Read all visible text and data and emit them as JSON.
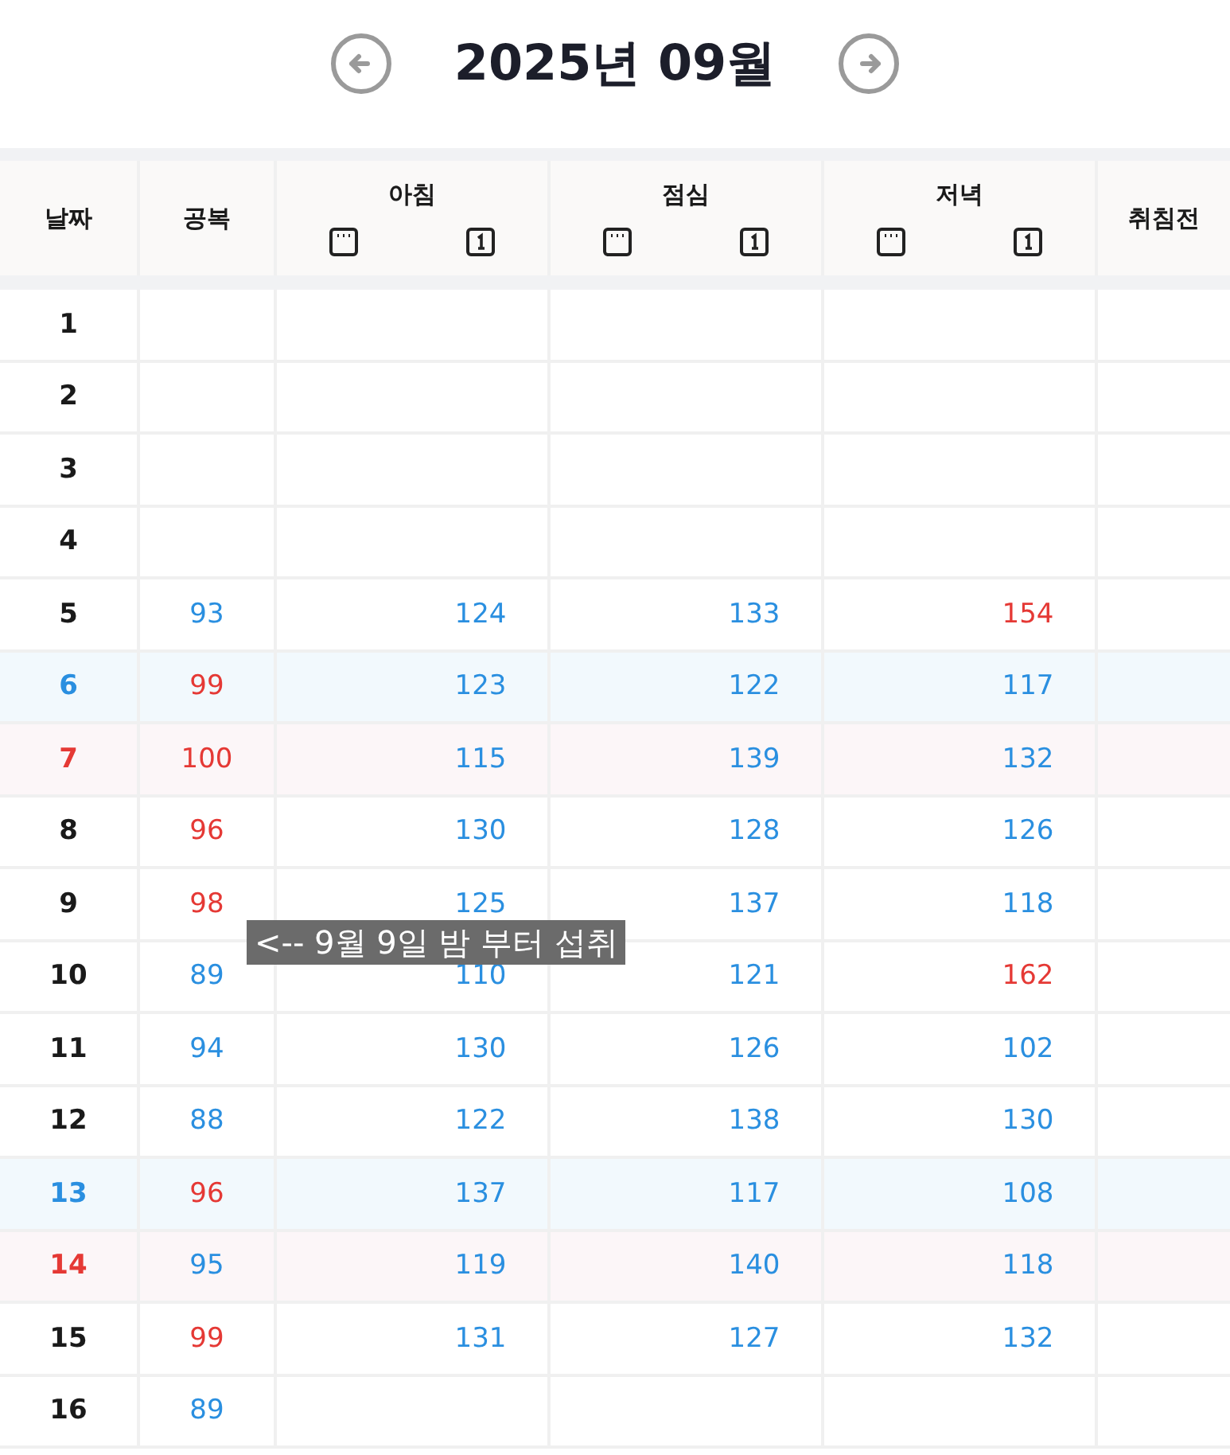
{
  "header": {
    "title": "2025년 09월"
  },
  "table": {
    "columns": [
      {
        "kind": "single",
        "label": "날짜"
      },
      {
        "kind": "single",
        "label": "공복"
      },
      {
        "kind": "meal",
        "label": "아침"
      },
      {
        "kind": "meal",
        "label": "점심"
      },
      {
        "kind": "meal",
        "label": "저녁"
      },
      {
        "kind": "single",
        "label": "취침전"
      }
    ],
    "rows": [
      {
        "date": "1",
        "kind": "weekday"
      },
      {
        "date": "2",
        "kind": "weekday"
      },
      {
        "date": "3",
        "kind": "weekday"
      },
      {
        "date": "4",
        "kind": "weekday"
      },
      {
        "date": "5",
        "kind": "weekday",
        "fasting": {
          "value": "93",
          "high": false
        },
        "breakfast": {
          "value": "124",
          "high": false
        },
        "lunch": {
          "value": "133",
          "high": false
        },
        "dinner": {
          "value": "154",
          "high": true
        }
      },
      {
        "date": "6",
        "kind": "saturday",
        "fasting": {
          "value": "99",
          "high": true
        },
        "breakfast": {
          "value": "123",
          "high": false
        },
        "lunch": {
          "value": "122",
          "high": false
        },
        "dinner": {
          "value": "117",
          "high": false
        }
      },
      {
        "date": "7",
        "kind": "sunday",
        "fasting": {
          "value": "100",
          "high": true
        },
        "breakfast": {
          "value": "115",
          "high": false
        },
        "lunch": {
          "value": "139",
          "high": false
        },
        "dinner": {
          "value": "132",
          "high": false
        }
      },
      {
        "date": "8",
        "kind": "weekday",
        "fasting": {
          "value": "96",
          "high": true
        },
        "breakfast": {
          "value": "130",
          "high": false
        },
        "lunch": {
          "value": "128",
          "high": false
        },
        "dinner": {
          "value": "126",
          "high": false
        }
      },
      {
        "date": "9",
        "kind": "weekday",
        "fasting": {
          "value": "98",
          "high": true
        },
        "breakfast": {
          "value": "125",
          "high": false
        },
        "lunch": {
          "value": "137",
          "high": false
        },
        "dinner": {
          "value": "118",
          "high": false
        }
      },
      {
        "date": "10",
        "kind": "weekday",
        "fasting": {
          "value": "89",
          "high": false
        },
        "breakfast": {
          "value": "110",
          "high": false
        },
        "lunch": {
          "value": "121",
          "high": false
        },
        "dinner": {
          "value": "162",
          "high": true
        }
      },
      {
        "date": "11",
        "kind": "weekday",
        "fasting": {
          "value": "94",
          "high": false
        },
        "breakfast": {
          "value": "130",
          "high": false
        },
        "lunch": {
          "value": "126",
          "high": false
        },
        "dinner": {
          "value": "102",
          "high": false
        }
      },
      {
        "date": "12",
        "kind": "weekday",
        "fasting": {
          "value": "88",
          "high": false
        },
        "breakfast": {
          "value": "122",
          "high": false
        },
        "lunch": {
          "value": "138",
          "high": false
        },
        "dinner": {
          "value": "130",
          "high": false
        }
      },
      {
        "date": "13",
        "kind": "saturday",
        "fasting": {
          "value": "96",
          "high": true
        },
        "breakfast": {
          "value": "137",
          "high": false
        },
        "lunch": {
          "value": "117",
          "high": false
        },
        "dinner": {
          "value": "108",
          "high": false
        }
      },
      {
        "date": "14",
        "kind": "sunday",
        "fasting": {
          "value": "95",
          "high": false
        },
        "breakfast": {
          "value": "119",
          "high": false
        },
        "lunch": {
          "value": "140",
          "high": false
        },
        "dinner": {
          "value": "118",
          "high": false
        }
      },
      {
        "date": "15",
        "kind": "weekday",
        "fasting": {
          "value": "99",
          "high": true
        },
        "breakfast": {
          "value": "131",
          "high": false
        },
        "lunch": {
          "value": "127",
          "high": false
        },
        "dinner": {
          "value": "132",
          "high": false
        }
      },
      {
        "date": "16",
        "kind": "weekday",
        "fasting": {
          "value": "89",
          "high": false
        }
      }
    ]
  },
  "annotation": "<-- 9월 9일 밤 부터 섭취"
}
